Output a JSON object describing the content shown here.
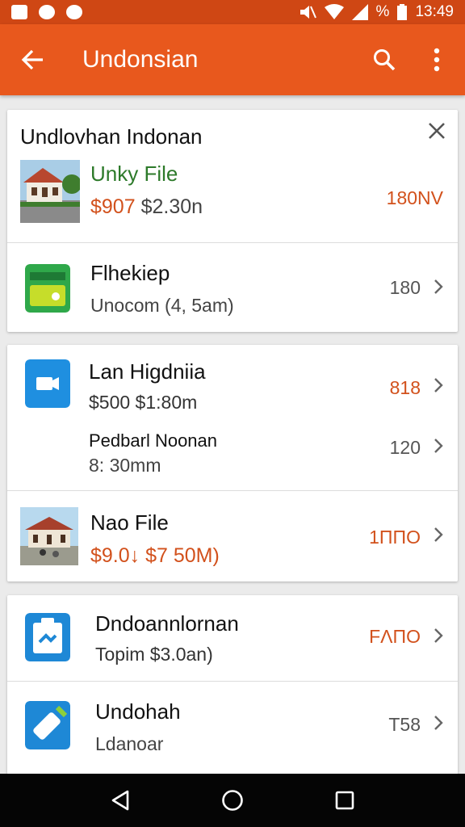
{
  "status_bar": {
    "battery": "%",
    "time": "13:49"
  },
  "app_bar": {
    "title": "Undonsian"
  },
  "card1": {
    "header": "Undlovhan Indonan",
    "rows": [
      {
        "title": "Unky File",
        "price": "$907",
        "sub": "$2.30n",
        "value": "180NV"
      },
      {
        "title": "Flhekiep",
        "sub": "Unocom (4, 5am)",
        "value": "180"
      }
    ]
  },
  "card2": {
    "rows": [
      {
        "title": "Lan Higdniia",
        "sub": "$500  $1:80m",
        "value": "818"
      },
      {
        "title": "Pedbarl Noonan",
        "sub": "8: 30mm",
        "value": "120"
      },
      {
        "title": "Nao File",
        "sub": "$9.0↓ $7 50M)",
        "value": "1ΠΠΟ"
      }
    ]
  },
  "card3": {
    "rows": [
      {
        "title": "Dndoannlornan",
        "sub": "Topim $3.0an)",
        "value": "FΛΠΟ"
      },
      {
        "title": "Undohah",
        "sub": "Ldanoar",
        "value": "T58"
      }
    ]
  },
  "colors": {
    "primary": "#e8581d",
    "status": "#cf4714",
    "accent_text": "#d2511c",
    "green_text": "#2d7a2a"
  }
}
